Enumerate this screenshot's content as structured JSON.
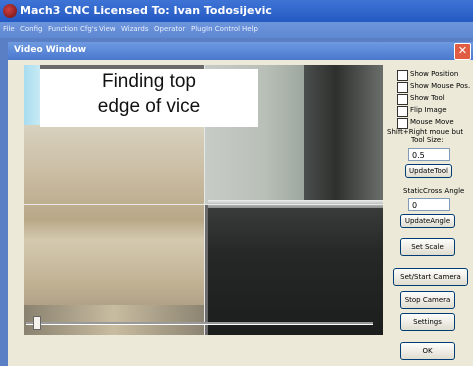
{
  "app": {
    "title": "Mach3 CNC  Licensed To: Ivan Todosijevic"
  },
  "menu": [
    "File",
    "Config",
    "Function Cfg's",
    "View",
    "Wizards",
    "Operator",
    "PlugIn Control",
    "Help"
  ],
  "dialog": {
    "title": "Video Window"
  },
  "video": {
    "overlay_line1": "Finding top",
    "overlay_line2": "edge of vice"
  },
  "options": {
    "show_position": "Show Position",
    "show_mouse_pos": "Show Mouse Pos.",
    "show_tool": "Show Tool",
    "flip_image": "Flip Image",
    "mouse_move": "Mouse Move",
    "mouse_move_hint": "Shift+Right moue but",
    "tool_size_label": "Tool Size:",
    "tool_size_value": "0.5",
    "update_tool": "UpdateTool",
    "static_cross_angle_label": "StaticCross Angle",
    "angle_value": "0",
    "update_angle": "UpdateAngle"
  },
  "buttons": {
    "set_scale": "Set Scale",
    "set_start_camera": "Set/Start Camera",
    "stop_camera": "Stop Camera",
    "settings": "Settings",
    "ok": "OK"
  },
  "slider": {
    "value": 0.02
  }
}
